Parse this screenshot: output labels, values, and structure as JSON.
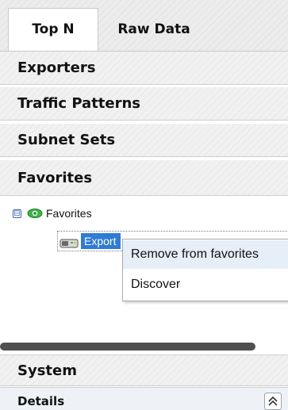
{
  "tabs": [
    {
      "label": "Top N",
      "active": true
    },
    {
      "label": "Raw Data",
      "active": false
    }
  ],
  "accordion": [
    {
      "label": "Exporters"
    },
    {
      "label": "Traffic Patterns"
    },
    {
      "label": "Subnet Sets"
    },
    {
      "label": "Favorites"
    }
  ],
  "tree": {
    "root": {
      "label": "Favorites",
      "expander": "⊟"
    },
    "child": {
      "label": "Export"
    }
  },
  "context_menu": {
    "items": [
      {
        "label": "Remove from favorites",
        "highlighted": true
      },
      {
        "label": "Discover"
      }
    ]
  },
  "bottom": {
    "system_label": "System",
    "details_label": "Details",
    "collapse_icon": "double-chevron-up"
  },
  "colors": {
    "selection": "#2f7bd6",
    "eye_icon": "#2a9d3a"
  }
}
